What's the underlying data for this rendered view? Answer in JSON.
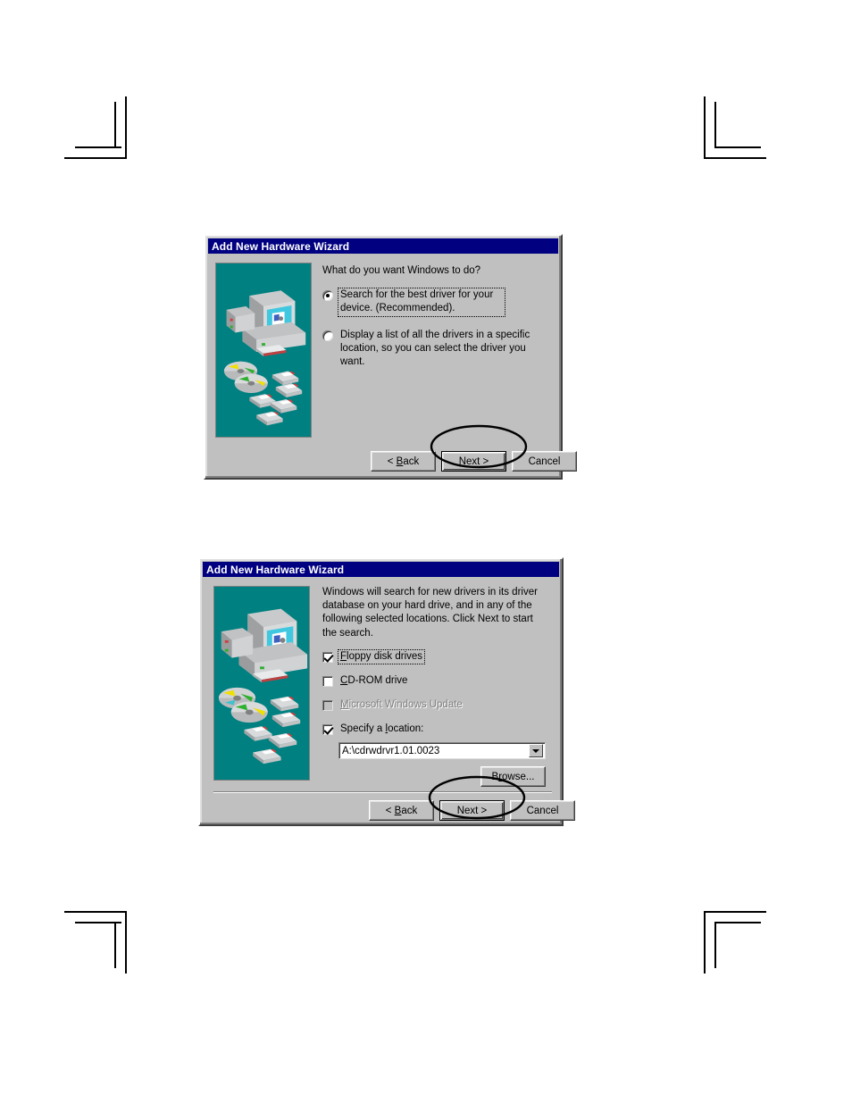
{
  "page": {
    "background": "#ffffff",
    "crop_marks": [
      "top-left",
      "top-right",
      "bottom-left",
      "bottom-right"
    ]
  },
  "colors": {
    "titlebar": "#000080",
    "dialog_face": "#c0c0c0",
    "artwork_background": "#008080",
    "text": "#000000",
    "disabled_text": "#808080",
    "field_background": "#ffffff",
    "annotation": "#000000"
  },
  "dialog_1": {
    "title": "Add New Hardware Wizard",
    "prompt": "What do you want Windows to do?",
    "options": [
      {
        "label": "Search for the best driver for your device. (Recommended).",
        "selected": true,
        "focused": true
      },
      {
        "label": "Display a list of all the drivers in a specific location, so you can select the driver you want.",
        "selected": false,
        "focused": false
      }
    ],
    "buttons": [
      {
        "label": "< Back",
        "accel": "B",
        "default": false,
        "annotated": false
      },
      {
        "label": "Next >",
        "accel": "",
        "default": true,
        "annotated": true
      },
      {
        "label": "Cancel",
        "accel": "",
        "default": false,
        "annotated": false
      }
    ],
    "artwork": "computer-with-cds-and-floppy-disks"
  },
  "dialog_2": {
    "title": "Add New Hardware Wizard",
    "prompt": "Windows will search for new drivers in its driver database on your hard drive, and in any of the following selected locations. Click Next to start the search.",
    "checkboxes": [
      {
        "label": "Floppy disk drives",
        "accel": "F",
        "checked": true,
        "disabled": false,
        "focused": true
      },
      {
        "label": "CD-ROM drive",
        "accel": "C",
        "checked": false,
        "disabled": false,
        "focused": false
      },
      {
        "label": "Microsoft Windows Update",
        "accel": "M",
        "checked": false,
        "disabled": true,
        "focused": false
      },
      {
        "label": "Specify a location:",
        "accel": "l",
        "checked": true,
        "disabled": false,
        "focused": false
      }
    ],
    "location_combo": {
      "value": "A:\\cdrwdrvr1.01.0023",
      "placeholder": "A:\\"
    },
    "browse_button": {
      "label": "Browse...",
      "accel": "r"
    },
    "buttons": [
      {
        "label": "< Back",
        "accel": "B",
        "default": false,
        "annotated": false
      },
      {
        "label": "Next >",
        "accel": "",
        "default": true,
        "annotated": true
      },
      {
        "label": "Cancel",
        "accel": "",
        "default": false,
        "annotated": false
      }
    ],
    "artwork": "computer-with-cds-and-floppy-disks"
  }
}
